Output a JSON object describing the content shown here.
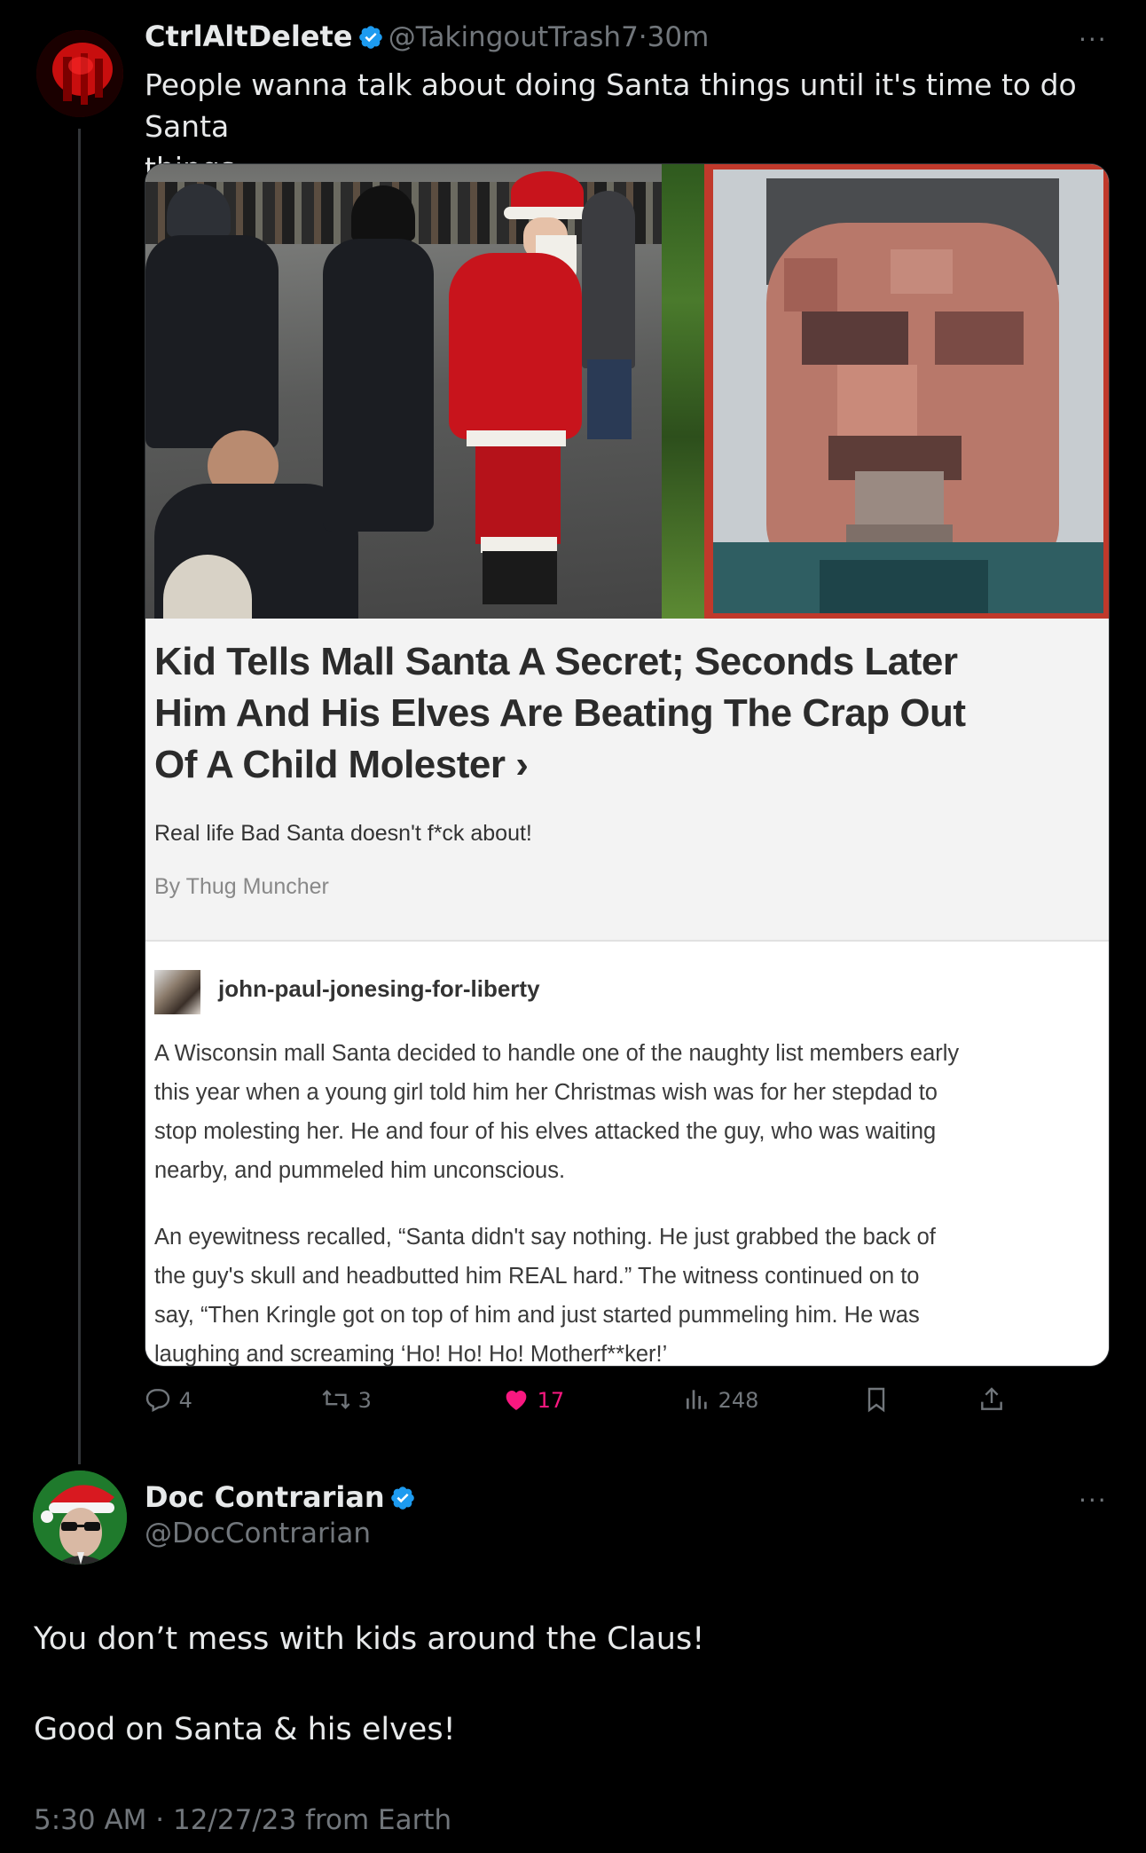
{
  "tweet": {
    "author_name": "CtrlAltDelete",
    "author_handle": "@TakingoutTrash7",
    "separator": "·",
    "time_ago": "30m",
    "more_label": "···",
    "text_line1": "People wanna talk about doing Santa things until it's time to do Santa",
    "text_line2": "things...",
    "media": {
      "headline_line1": "Kid Tells Mall Santa A Secret; Seconds Later",
      "headline_line2": "Him And His Elves Are Beating The Crap Out",
      "headline_line3": "Of A Child Molester",
      "headline_chevron": "›",
      "subline": "Real life Bad Santa doesn't f*ck about!",
      "byline": "By Thug Muncher",
      "post_author": "john-paul-jonesing-for-liberty",
      "para1": [
        "A Wisconsin mall Santa decided to handle one of the naughty list members early",
        "this year when a young girl told him her Christmas wish was for her stepdad to",
        "stop molesting her. He and four of his elves attacked the guy, who was waiting",
        "nearby, and pummeled him unconscious."
      ],
      "para2": [
        "An eyewitness recalled, “Santa didn't say nothing. He just grabbed the back of",
        "the guy's skull and headbutted him REAL hard.” The witness continued on to",
        "say, “Then Kringle got on top of him and just started pummeling him. He was",
        "laughing and screaming ‘Ho! Ho! Ho! Motherf**ker!’"
      ]
    },
    "actions": {
      "replies": "4",
      "retweets": "3",
      "likes": "17",
      "views": "248"
    }
  },
  "reply": {
    "author_name": "Doc Contrarian",
    "author_handle": "@DocContrarian",
    "more_label": "···",
    "text_line1": "You don’t mess with kids around the Claus!",
    "text_line2": "Good on Santa & his elves!",
    "timestamp": "5:30 AM · 12/27/23 from Earth"
  },
  "colors": {
    "background": "#000000",
    "primary_text": "#e7e9ea",
    "secondary_text": "#71767b",
    "verified": "#1d9bf0",
    "like": "#f91880"
  },
  "icons": [
    "verified-badge-icon",
    "more-icon",
    "reply-icon",
    "retweet-icon",
    "like-icon",
    "views-icon",
    "bookmark-icon",
    "share-icon",
    "chevron-right-icon"
  ]
}
